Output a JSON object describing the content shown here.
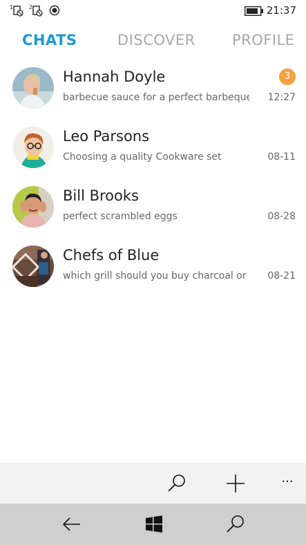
{
  "status_bar": {
    "notif1_label": "1",
    "notif2_label": "2",
    "time": "21:37"
  },
  "tabs": [
    {
      "label": "CHATS",
      "active": true
    },
    {
      "label": "DISCOVER",
      "active": false
    },
    {
      "label": "PROFILE",
      "active": false
    }
  ],
  "chats": [
    {
      "name": "Hannah Doyle",
      "preview": "barbecue sauce for a perfect barbeque",
      "time": "12:27",
      "unread": "3"
    },
    {
      "name": "Leo Parsons",
      "preview": "Choosing a quality Cookware set",
      "time": "08-11"
    },
    {
      "name": "Bill Brooks",
      "preview": "perfect scrambled eggs",
      "time": "08-28"
    },
    {
      "name": "Chefs of Blue",
      "preview": "which grill should you buy charcoal or",
      "time": "08-21"
    }
  ],
  "app_bar": {
    "more_label": "···"
  },
  "colors": {
    "accent": "#1b9ad8",
    "badge": "#f4a142",
    "inactive_tab": "#a8a8a8"
  },
  "icons": [
    "notification-icon",
    "record-icon",
    "battery-icon",
    "search-icon",
    "add-icon",
    "more-icon",
    "back-icon",
    "windows-icon"
  ]
}
